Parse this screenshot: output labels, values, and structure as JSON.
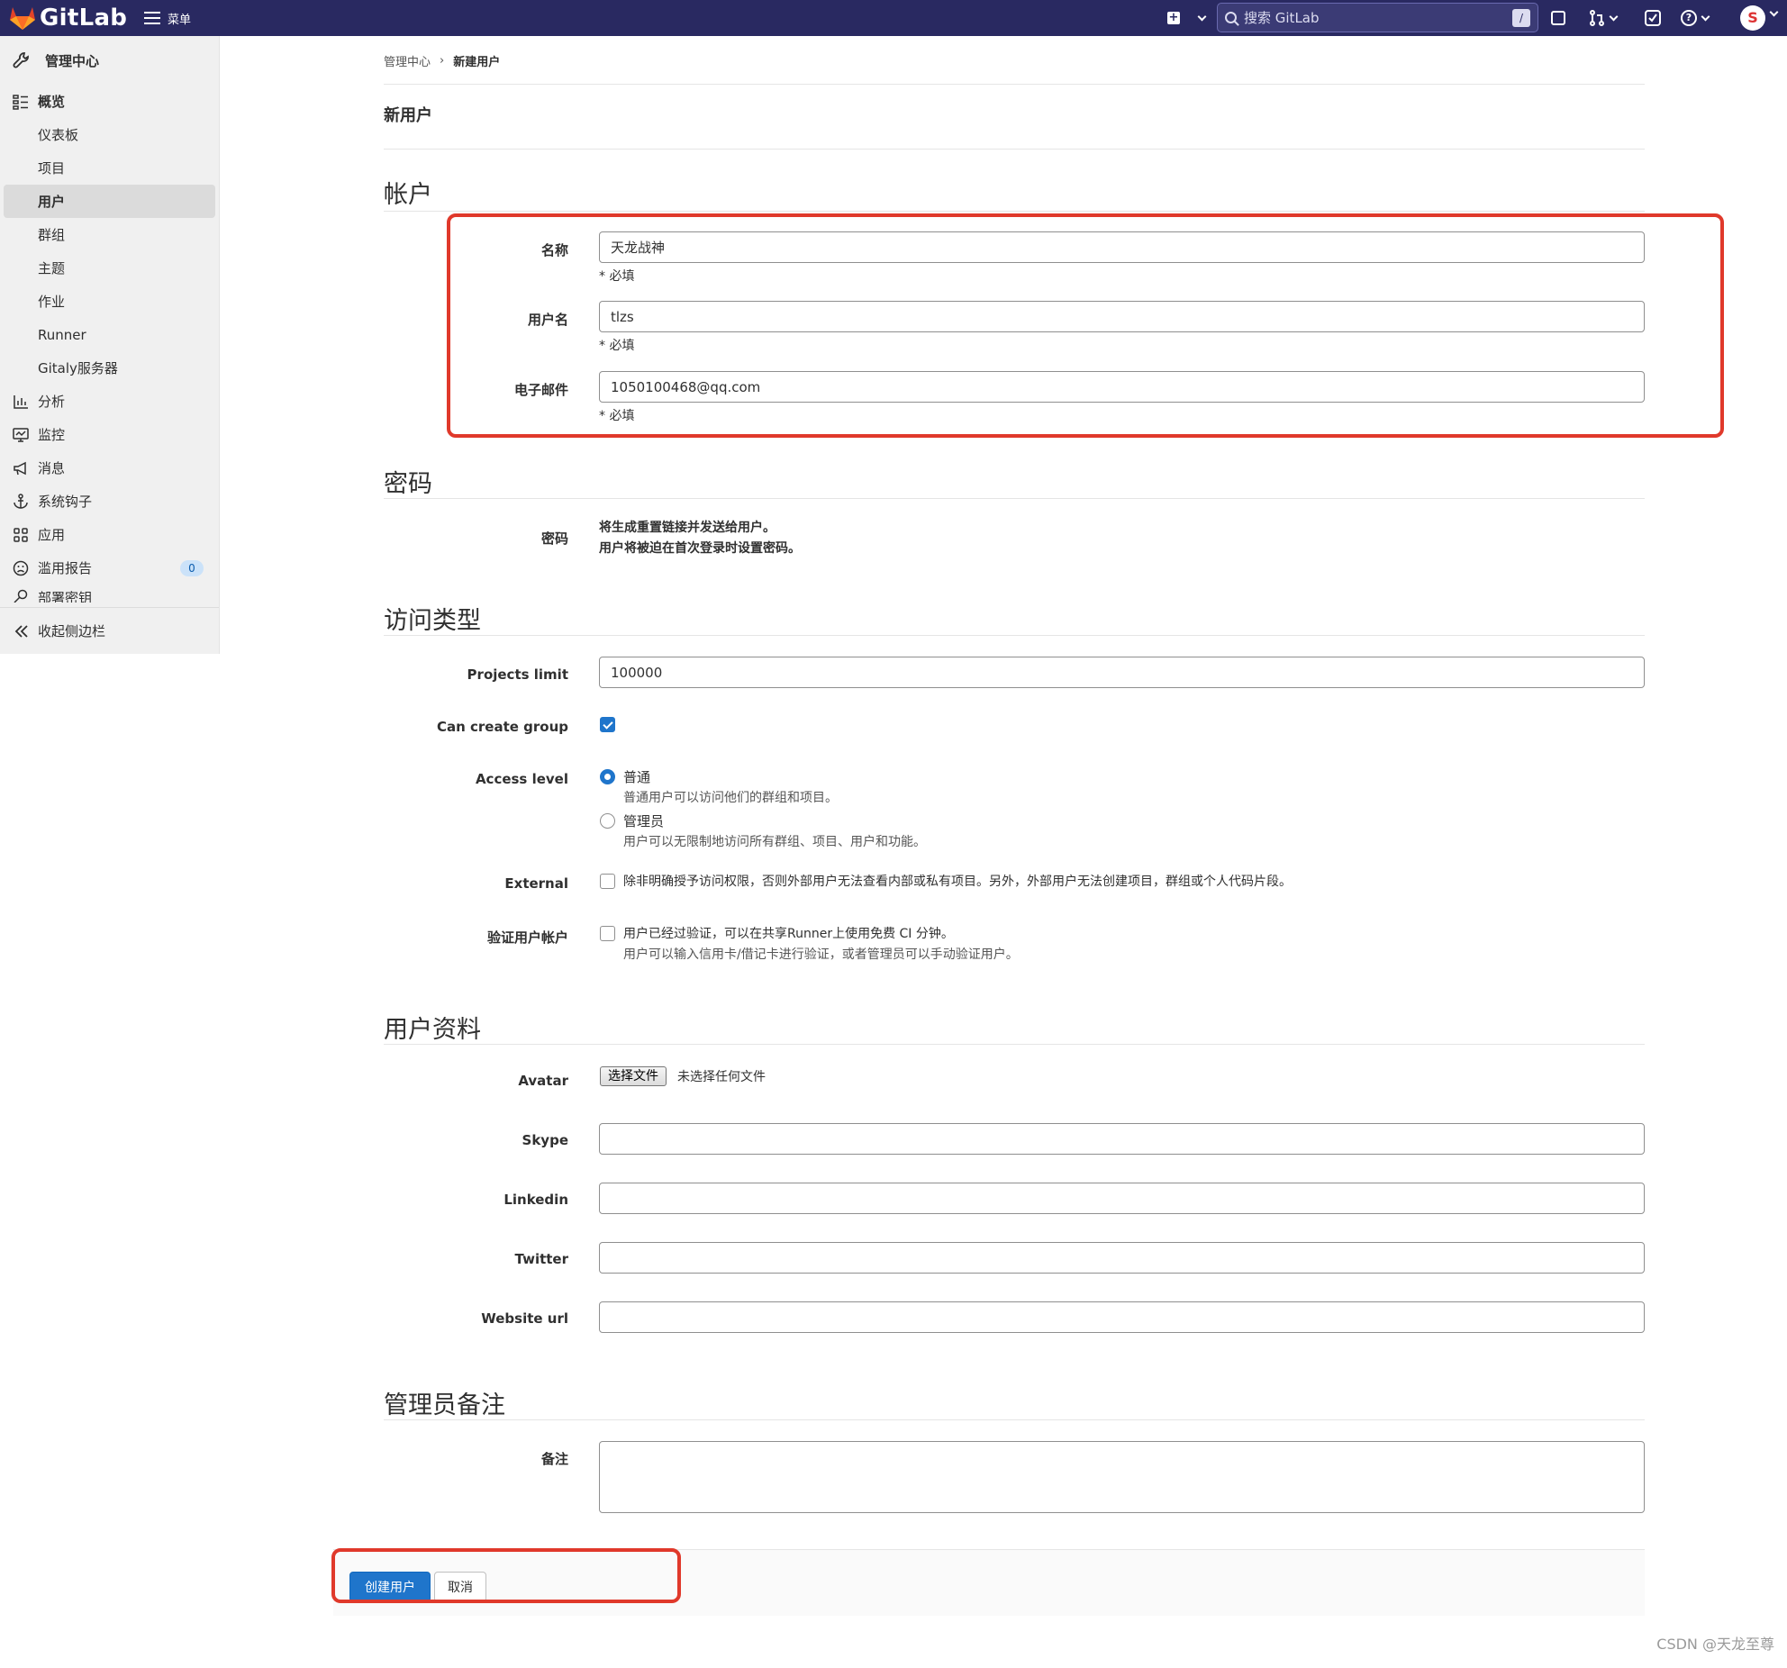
{
  "navbar": {
    "brand": "GitLab",
    "menu_label": "菜单",
    "search_placeholder": "搜索 GitLab",
    "search_shortcut": "/",
    "avatar_letter": "S",
    "bg_color": "#292961"
  },
  "sidebar": {
    "header": "管理中心",
    "overview": "概览",
    "sub_items": [
      "仪表板",
      "项目",
      "用户",
      "群组",
      "主题",
      "作业",
      "Runner",
      "Gitaly服务器"
    ],
    "active_item": "用户",
    "items": [
      {
        "label": "分析",
        "icon": "chart-icon"
      },
      {
        "label": "监控",
        "icon": "monitor-icon"
      },
      {
        "label": "消息",
        "icon": "megaphone-icon"
      },
      {
        "label": "系统钩子",
        "icon": "anchor-icon"
      },
      {
        "label": "应用",
        "icon": "apps-icon"
      },
      {
        "label": "滥用报告",
        "icon": "abuse-icon",
        "badge": "0"
      }
    ],
    "clipped_item": "部署密钥",
    "collapse_label": "收起侧边栏"
  },
  "breadcrumb": {
    "parent": "管理中心",
    "separator": "›",
    "current": "新建用户"
  },
  "page": {
    "title": "新用户",
    "account": {
      "section": "帐户",
      "name_label": "名称",
      "name_value": "天龙战神",
      "username_label": "用户名",
      "username_value": "tlzs",
      "email_label": "电子邮件",
      "email_value": "1050100468@qq.com",
      "required": "* 必填"
    },
    "password": {
      "section": "密码",
      "label": "密码",
      "line1": "将生成重置链接并发送给用户。",
      "line2": "用户将被迫在首次登录时设置密码。"
    },
    "access": {
      "section": "访问类型",
      "projects_limit_label": "Projects limit",
      "projects_limit_value": "100000",
      "can_create_group_label": "Can create group",
      "can_create_group_checked": true,
      "access_level_label": "Access level",
      "regular_label": "普通",
      "regular_help": "普通用户可以访问他们的群组和项目。",
      "admin_label": "管理员",
      "admin_help": "用户可以无限制地访问所有群组、项目、用户和功能。",
      "selected_level": "普通",
      "external_label": "External",
      "external_help": "除非明确授予访问权限，否则外部用户无法查看内部或私有项目。另外，外部用户无法创建项目，群组或个人代码片段。",
      "validate_label": "验证用户帐户",
      "validate_line1": "用户已经过验证，可以在共享Runner上使用免费 CI 分钟。",
      "validate_line2": "用户可以输入信用卡/借记卡进行验证，或者管理员可以手动验证用户。"
    },
    "profile": {
      "section": "用户资料",
      "avatar_label": "Avatar",
      "file_button": "选择文件",
      "file_none": "未选择任何文件",
      "skype_label": "Skype",
      "linkedin_label": "Linkedin",
      "twitter_label": "Twitter",
      "website_label": "Website url"
    },
    "admin_notes": {
      "section": "管理员备注",
      "note_label": "备注"
    },
    "actions": {
      "create": "创建用户",
      "cancel": "取消"
    }
  },
  "watermark": "CSDN @天龙至尊",
  "colors": {
    "primary": "#1f75cb",
    "highlight_box": "#e0392b"
  }
}
